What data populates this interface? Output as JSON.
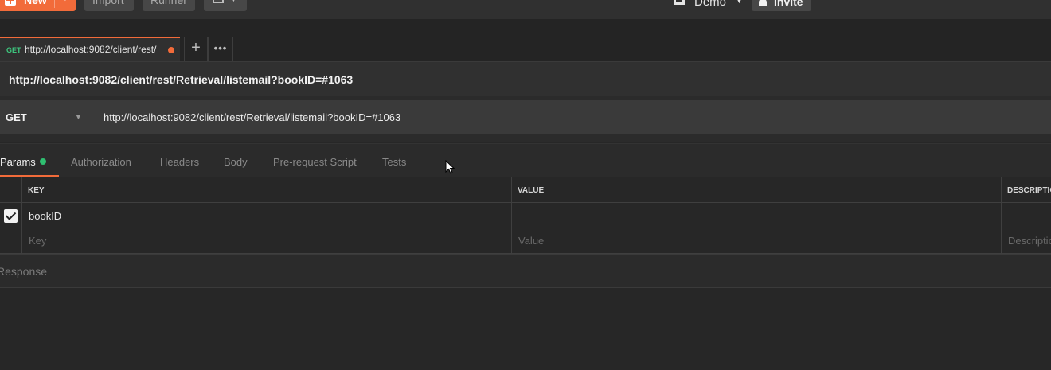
{
  "topbar": {
    "new_label": "New",
    "import_label": "Import",
    "runner_label": "Runner",
    "workspace_name": "Demo",
    "invite_label": "Invite"
  },
  "tab": {
    "method": "GET",
    "url": "http://localhost:9082/client/rest/"
  },
  "request": {
    "name": "http://localhost:9082/client/rest/Retrieval/listemail?bookID=#1063",
    "method": "GET",
    "url": "http://localhost:9082/client/rest/Retrieval/listemail?bookID=#1063"
  },
  "subtabs": {
    "params": "Params",
    "authorization": "Authorization",
    "headers": "Headers",
    "body": "Body",
    "prerequest": "Pre-request Script",
    "tests": "Tests"
  },
  "params_table": {
    "columns": [
      "KEY",
      "VALUE",
      "DESCRIPTION"
    ],
    "rows": [
      {
        "checked": true,
        "key": "bookID",
        "value": "",
        "description": ""
      }
    ],
    "placeholders": {
      "key": "Key",
      "value": "Value",
      "description": "Description"
    }
  },
  "response": {
    "label": "Response"
  },
  "colors": {
    "accent": "#f26b3a",
    "method_get": "#3ec97f",
    "params_dot": "#2fbf71",
    "background": "#272727"
  }
}
